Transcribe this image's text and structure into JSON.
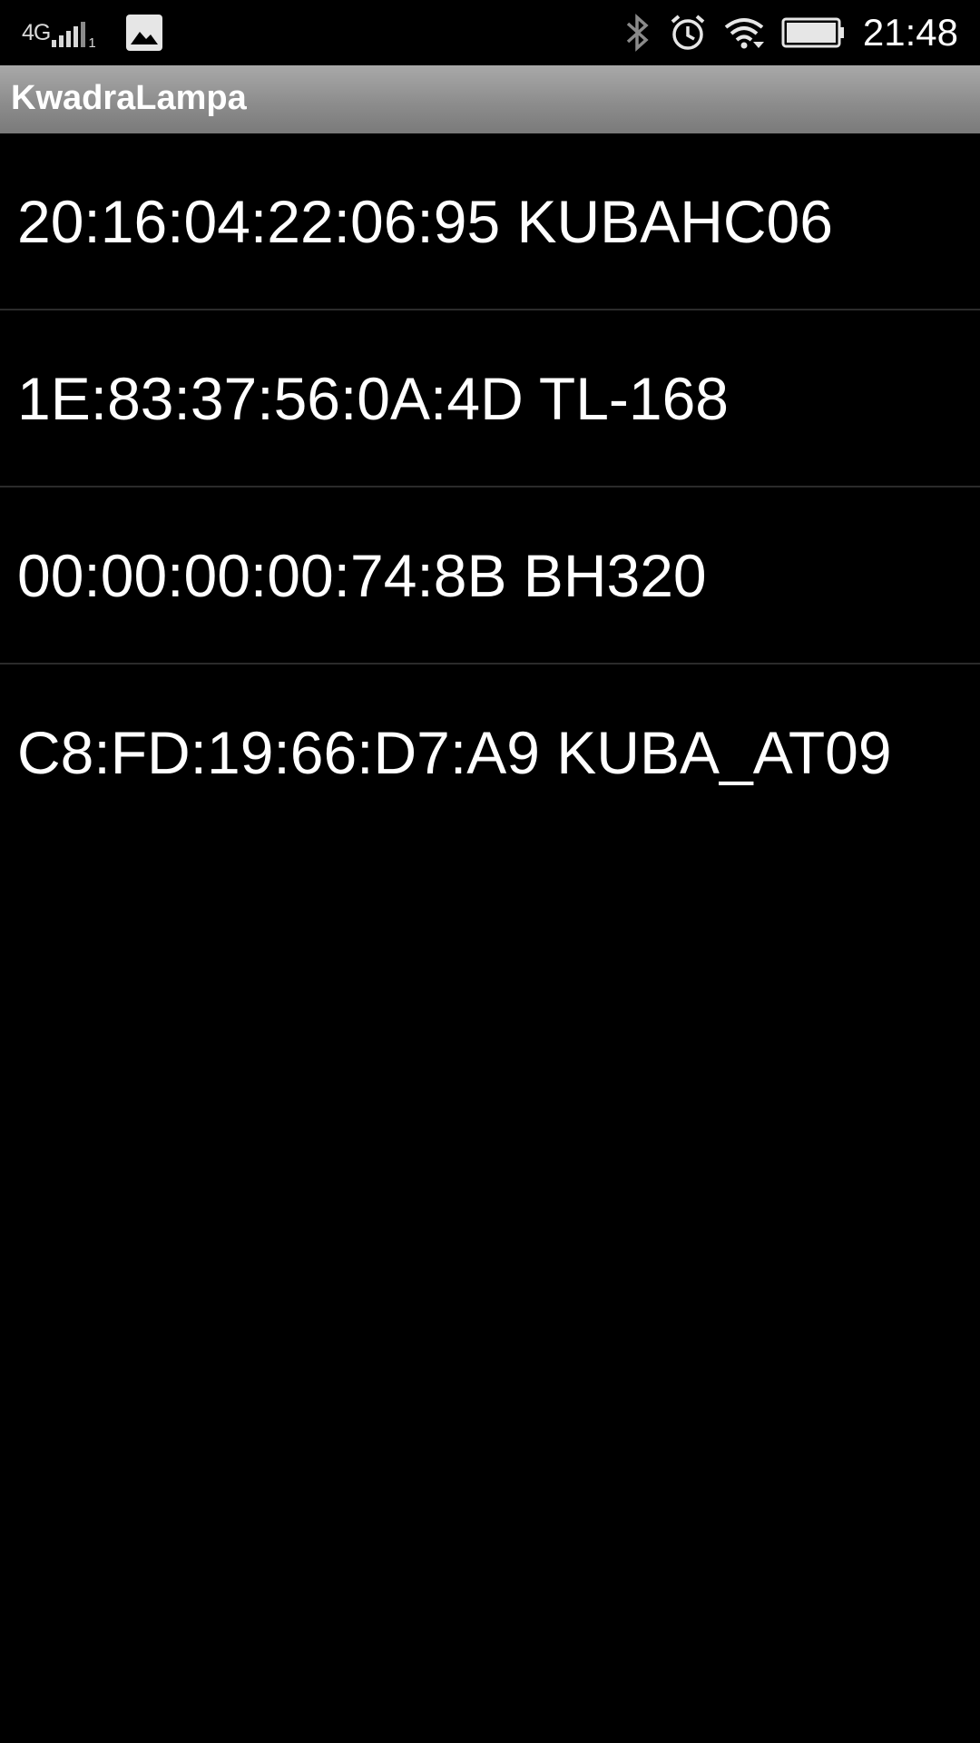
{
  "status_bar": {
    "network_type": "4G",
    "sim_slot": "1",
    "time": "21:48",
    "icons": [
      "signal-icon",
      "image-notification-icon",
      "bluetooth-icon",
      "alarm-icon",
      "wifi-icon",
      "battery-icon"
    ]
  },
  "app": {
    "title": "KwadraLampa"
  },
  "devices": [
    {
      "label": "20:16:04:22:06:95 KUBAHC06"
    },
    {
      "label": "1E:83:37:56:0A:4D TL-168"
    },
    {
      "label": "00:00:00:00:74:8B BH320"
    },
    {
      "label": "C8:FD:19:66:D7:A9 KUBA_AT09"
    }
  ],
  "colors": {
    "background": "#000000",
    "action_bar": "#8d8d8d",
    "text": "#ffffff",
    "divider": "#2b2b2b"
  }
}
